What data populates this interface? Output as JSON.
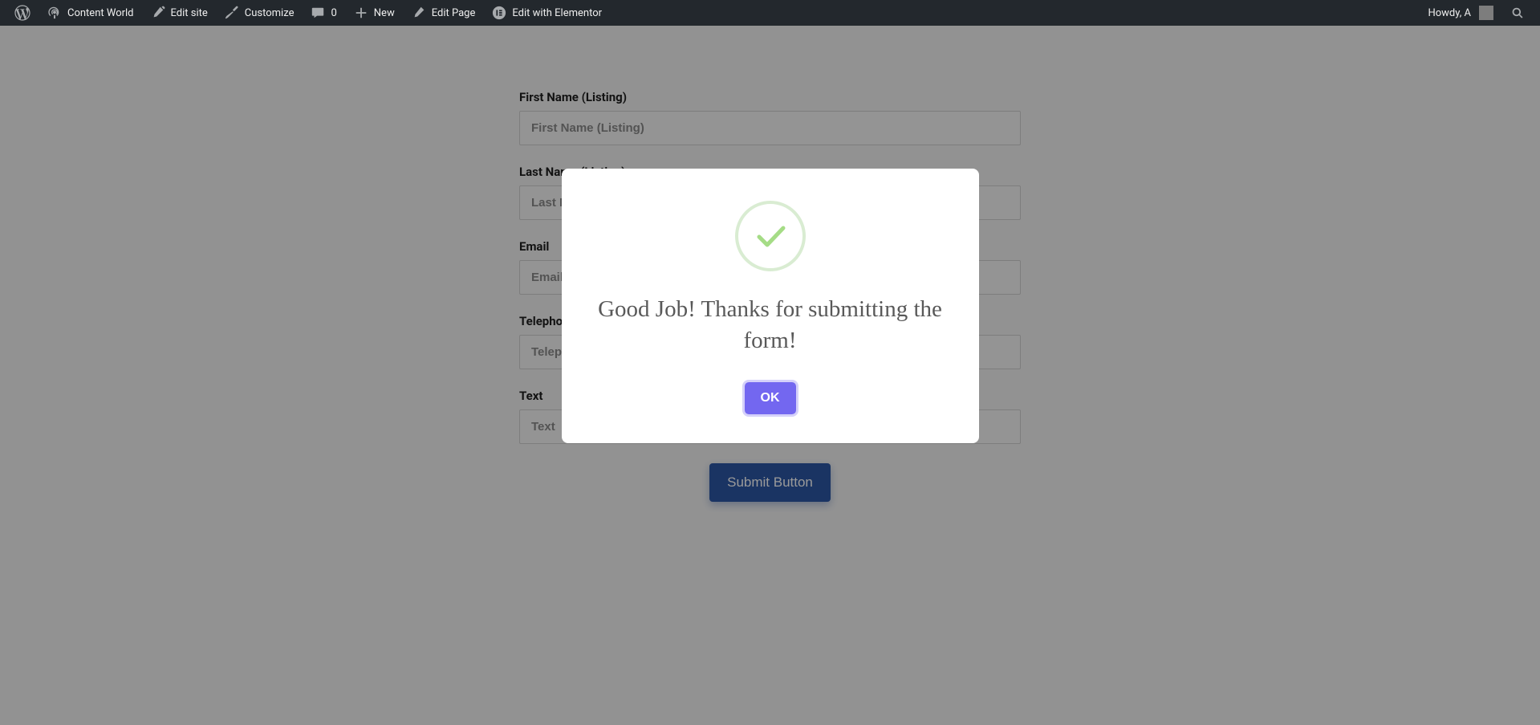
{
  "adminBar": {
    "siteName": "Content World",
    "editSite": "Edit site",
    "customize": "Customize",
    "commentCount": "0",
    "new": "New",
    "editPage": "Edit Page",
    "editElementor": "Edit with Elementor",
    "greeting": "Howdy, A"
  },
  "form": {
    "fields": [
      {
        "label": "First Name (Listing)",
        "placeholder": "First Name (Listing)"
      },
      {
        "label": "Last Name (Listing)",
        "placeholder": "Last Name (Listing)"
      },
      {
        "label": "Email",
        "placeholder": "Email"
      },
      {
        "label": "Telephone (Listing)",
        "placeholder": "Telephone (Listing)"
      },
      {
        "label": "Text",
        "placeholder": "Text"
      }
    ],
    "submitLabel": "Submit Button"
  },
  "modal": {
    "message": "Good Job! Thanks for submitting the form!",
    "okLabel": "OK"
  }
}
